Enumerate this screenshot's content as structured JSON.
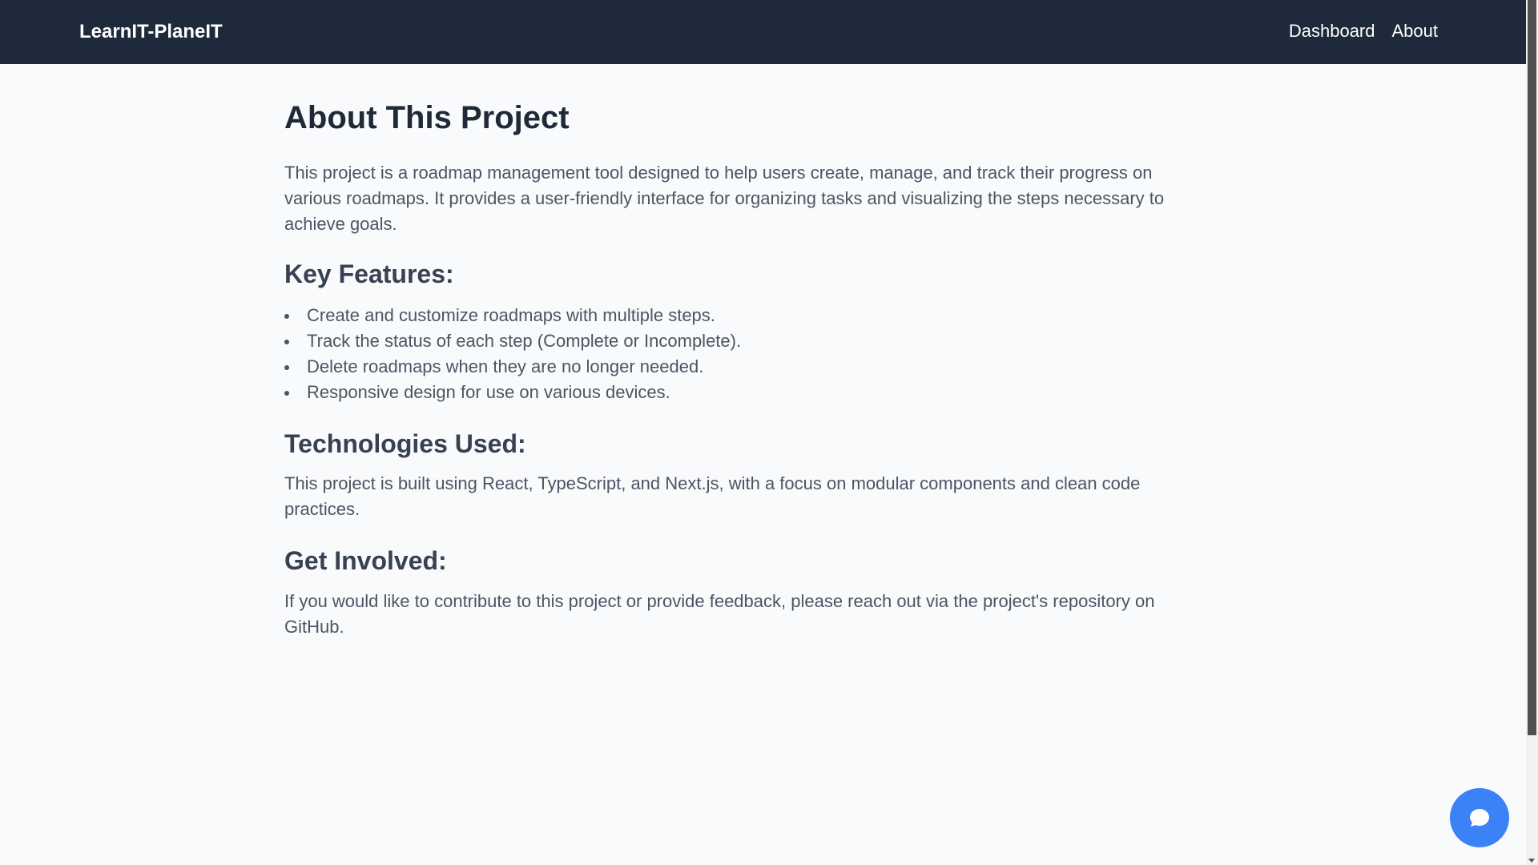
{
  "navbar": {
    "brand": "LearnIT-PlaneIT",
    "links": [
      "Dashboard",
      "About"
    ]
  },
  "about": {
    "title": "About This Project",
    "intro": "This project is a roadmap management tool designed to help users create, manage, and track their progress on various roadmaps. It provides a user-friendly interface for organizing tasks and visualizing the steps necessary to achieve goals.",
    "features_heading": "Key Features:",
    "features": [
      "Create and customize roadmaps with multiple steps.",
      "Track the status of each step (Complete or Incomplete).",
      "Delete roadmaps when they are no longer needed.",
      "Responsive design for use on various devices."
    ],
    "tech_heading": "Technologies Used:",
    "tech_text": "This project is built using React, TypeScript, and Next.js, with a focus on modular components and clean code practices.",
    "involved_heading": "Get Involved:",
    "involved_text": "If you would like to contribute to this project or provide feedback, please reach out via the project's repository on GitHub."
  },
  "chat_widget": {
    "icon": "chat-bubble-icon",
    "color": "#3b82f6"
  },
  "colors": {
    "navbar_bg": "#1e293b",
    "page_bg": "#f8fafc",
    "heading": "#1f2937",
    "body_text": "#4b5563"
  }
}
